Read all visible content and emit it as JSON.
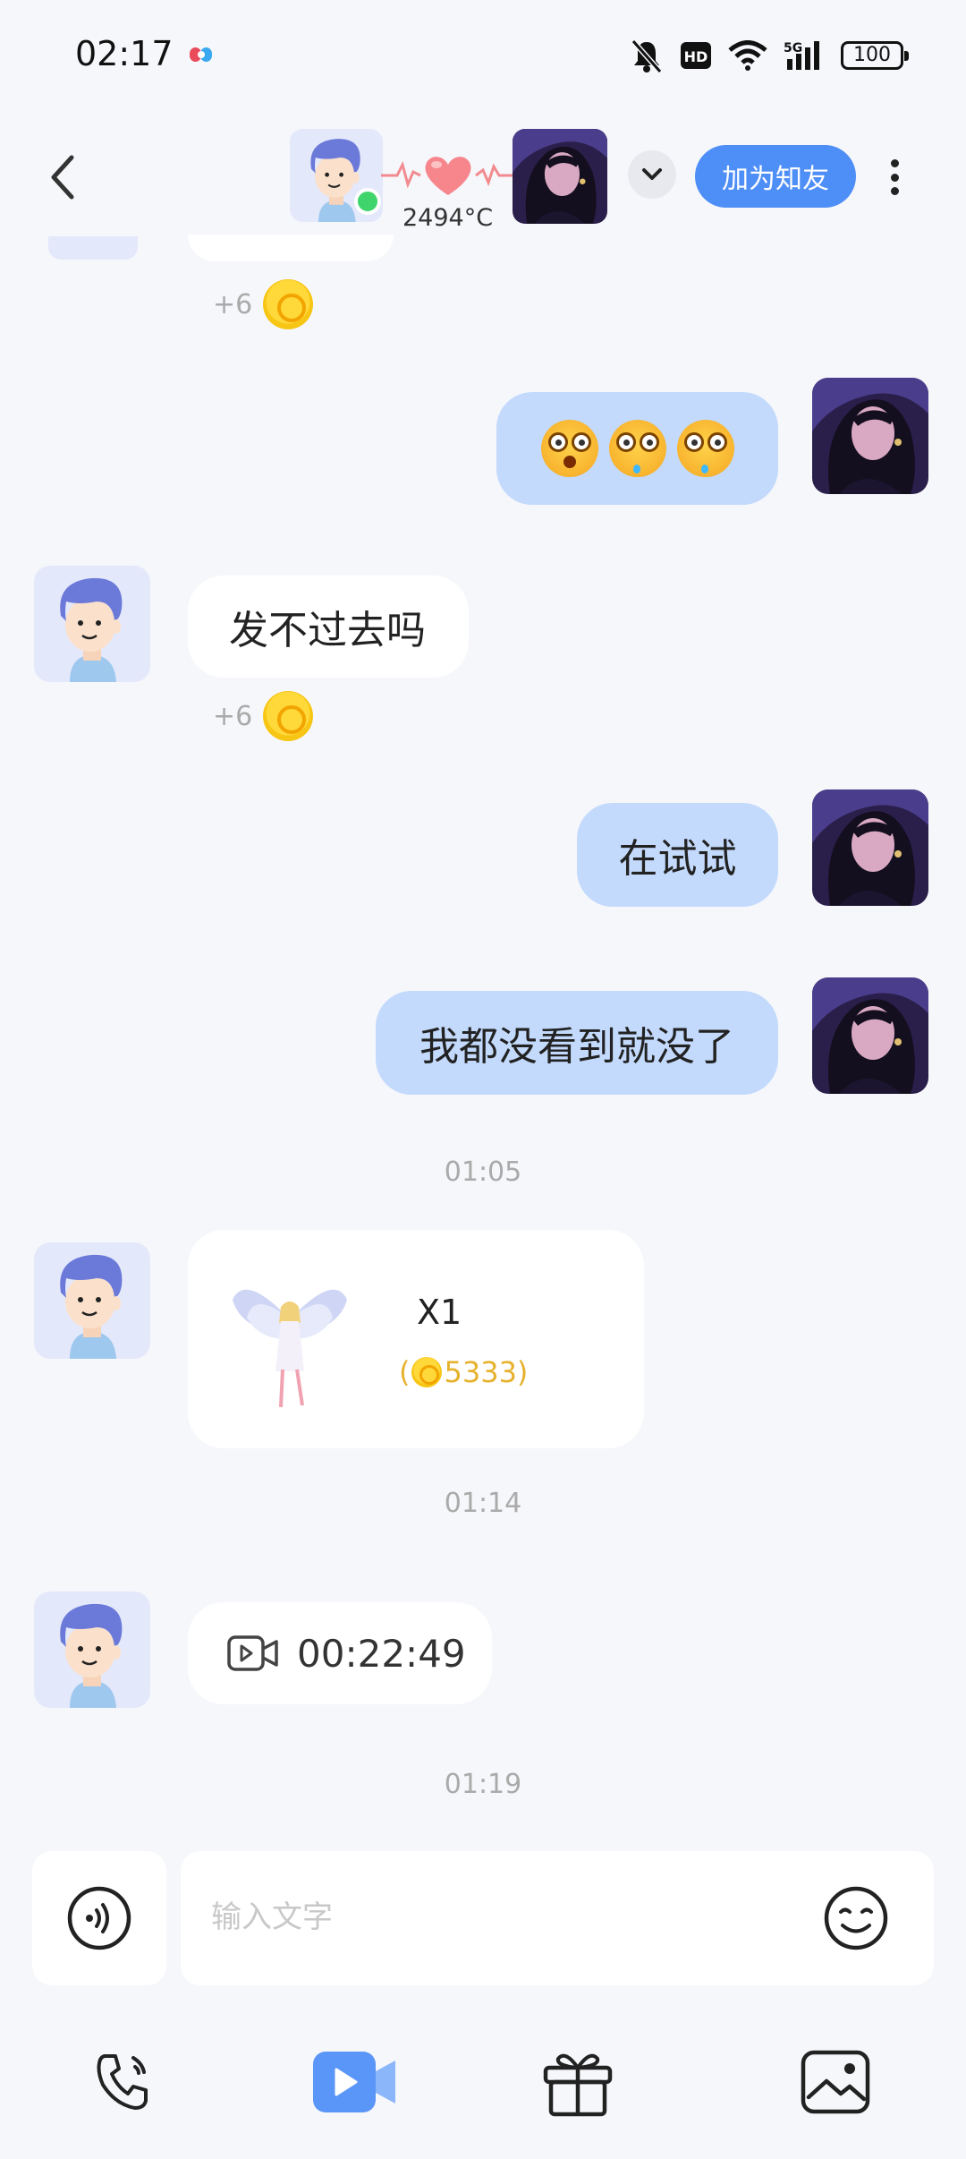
{
  "status_bar": {
    "time": "02:17",
    "hd": "HD",
    "network": "5G",
    "battery": "100"
  },
  "header": {
    "intimacy": "2494°C",
    "add_friend_label": "加为知友"
  },
  "messages": {
    "reward_1": "+6",
    "incoming_1": "发不过去吗",
    "reward_2": "+6",
    "outgoing_1": "在试试",
    "outgoing_2": "我都没看到就没了",
    "time_1": "01:05",
    "gift": {
      "count": "X1",
      "price_prefix": "(",
      "price": "5333",
      "price_suffix": ")"
    },
    "time_2": "01:14",
    "call_duration": "00:22:49",
    "time_3": "01:19"
  },
  "input": {
    "placeholder": "输入文字"
  },
  "colors": {
    "accent": "#4e8ef7",
    "outgoing_bubble": "#c3dafc",
    "coin": "#ffd83a",
    "online": "#3fd56c",
    "gift_price": "#e6b22e"
  }
}
